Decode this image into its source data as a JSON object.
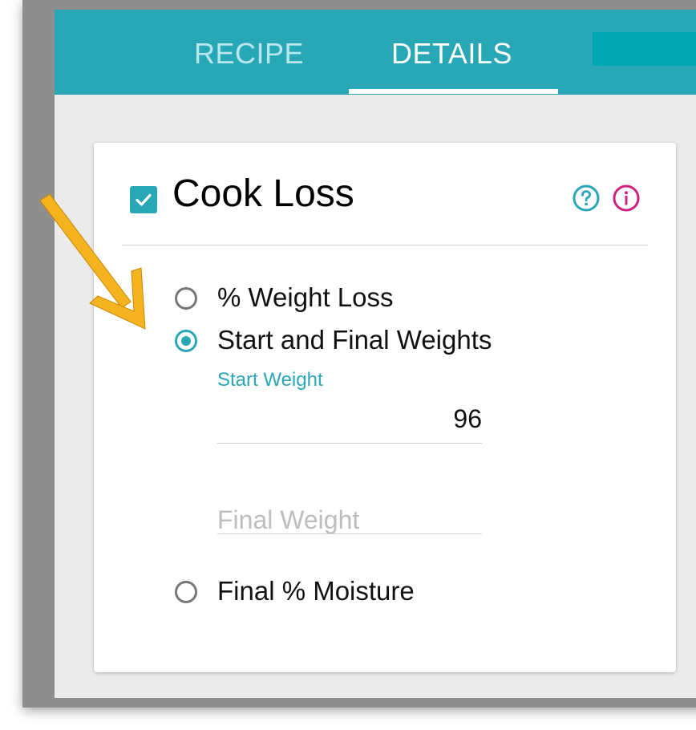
{
  "tabs": [
    {
      "label": "RECIPE",
      "active": false
    },
    {
      "label": "DETAILS",
      "active": true
    }
  ],
  "colors": {
    "accent": "#28a7b6",
    "info": "#d0207f",
    "annotation_arrow": "#f5b320"
  },
  "card": {
    "title": "Cook Loss",
    "enabled": true,
    "icons": [
      "help-icon",
      "info-icon"
    ],
    "options": [
      {
        "label": "% Weight Loss",
        "selected": false
      },
      {
        "label": "Start and Final Weights",
        "selected": true
      },
      {
        "label": "Final % Moisture",
        "selected": false
      }
    ],
    "start_weight": {
      "label": "Start Weight",
      "value": "96"
    },
    "final_weight": {
      "placeholder": "Final Weight",
      "value": ""
    }
  }
}
